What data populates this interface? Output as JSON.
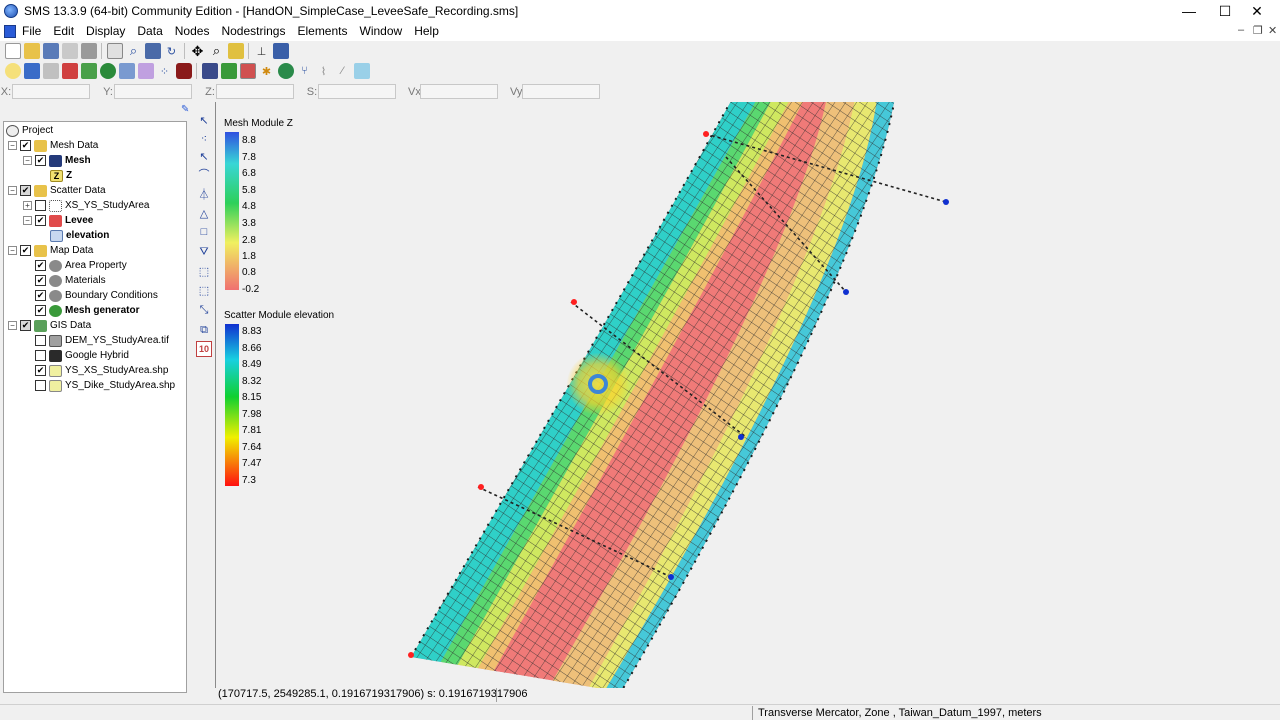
{
  "window": {
    "title": "SMS 13.3.9 (64-bit) Community Edition - [HandON_SimpleCase_LeveeSafe_Recording.sms]",
    "minimize": "—",
    "maximize": "☐",
    "close": "✕"
  },
  "menu": [
    "File",
    "Edit",
    "Display",
    "Data",
    "Nodes",
    "Nodestrings",
    "Elements",
    "Window",
    "Help"
  ],
  "mdi": {
    "minimize": "–",
    "restore": "❐",
    "close": "✕"
  },
  "coords": {
    "x": "X:",
    "y": "Y:",
    "z": "Z:",
    "s": "S:",
    "vx": "Vx:",
    "vy": "Vy:"
  },
  "tree": {
    "project": "Project",
    "mesh_data": "Mesh Data",
    "mesh": "Mesh",
    "z": "Z",
    "scatter_data": "Scatter Data",
    "xs_study": "XS_YS_StudyArea",
    "levee": "Levee",
    "elevation": "elevation",
    "map_data": "Map Data",
    "area_property": "Area Property",
    "materials": "Materials",
    "boundary_conditions": "Boundary Conditions",
    "mesh_generator": "Mesh generator",
    "gis_data": "GIS Data",
    "dem": "DEM_YS_StudyArea.tif",
    "google_hybrid": "Google Hybrid",
    "xs_shp": "YS_XS_StudyArea.shp",
    "dike_shp": "YS_Dike_StudyArea.shp"
  },
  "legend_z": {
    "title": "Mesh Module Z",
    "labels": [
      "8.8",
      "7.8",
      "6.8",
      "5.8",
      "4.8",
      "3.8",
      "2.8",
      "1.8",
      "0.8",
      "-0.2"
    ]
  },
  "legend_elev": {
    "title": "Scatter Module elevation",
    "labels": [
      "8.83",
      "8.66",
      "8.49",
      "8.32",
      "8.15",
      "7.98",
      "7.81",
      "7.64",
      "7.47",
      "7.3"
    ]
  },
  "colors": {
    "ramp_top": "#3050e0",
    "ramp_cyan": "#38d6d6",
    "ramp_green": "#2ed05a",
    "ramp_yellow": "#f0f060",
    "ramp_bottom": "#f07070",
    "scatter_top": "#1030d0",
    "scatter_bottom": "#ff1010"
  },
  "status": {
    "readout": "(170717.5, 2549285.1, 0.1916719317906) s: 0.1916719317906",
    "projection": "Transverse Mercator, Zone , Taiwan_Datum_1997, meters"
  }
}
